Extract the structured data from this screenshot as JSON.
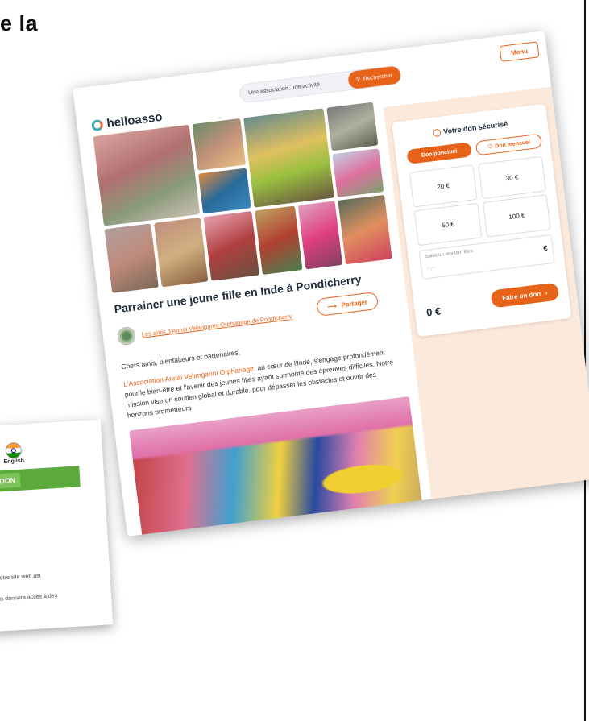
{
  "fragment_title": "e la",
  "header": {
    "logo_text": "helloasso",
    "search_placeholder": "Une association, une activité",
    "search_button": "Rechercher",
    "menu_label": "Menu"
  },
  "campaign": {
    "title": "Parrainer une jeune fille en Inde à Pondicherry",
    "organization": "Les amis d'Annai Velanganni Orphanage de Pondicherry",
    "share_label": "Partager",
    "greeting": "Chers amis, bienfaiteurs et partenaires,",
    "body_highlight": "L'Association Annai Velanganni Orphanage",
    "body_rest": ", au cœur de l'Inde, s'engage profondément pour le bien-être et l'avenir des jeunes filles ayant surmonté des épreuves difficiles. Notre mission vise un soutien global et durable, pour dépasser les obstacles et ouvrir des horizons prometteurs"
  },
  "donation": {
    "title": "Votre don sécurisé",
    "tab_once": "Don ponctuel",
    "tab_monthly": "Don mensuel",
    "amounts": [
      "20 €",
      "30 €",
      "50 €",
      "100 €"
    ],
    "free_label": "Saisir un montant libre",
    "free_placeholder": "--,--",
    "currency": "€",
    "total": "0 €",
    "submit_label": "Faire un don"
  },
  "secondary_card": {
    "language": "English",
    "donate_label": "N DON",
    "line1": "r notre site web ast",
    "line2": "ous donnera accès à des"
  },
  "colors": {
    "accent": "#e8631a",
    "panel_background": "#fbe9dc",
    "secondary_bar": "#5caa3a"
  }
}
